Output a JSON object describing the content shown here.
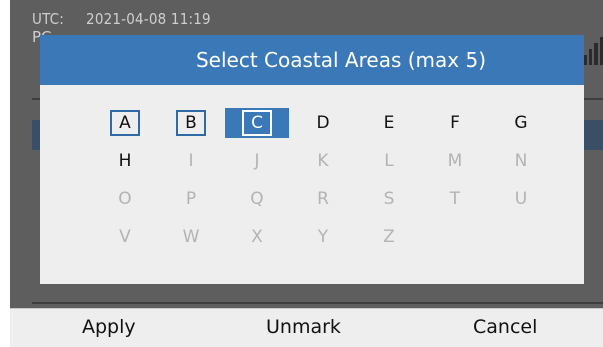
{
  "status": {
    "utc_label": "UTC:",
    "utc_value": "2021-04-08  11:19",
    "line2": "PC"
  },
  "dialog": {
    "title": "Select Coastal Areas (max 5)"
  },
  "areas": [
    {
      "letter": "A",
      "enabled": true,
      "marked": true,
      "focused": false
    },
    {
      "letter": "B",
      "enabled": true,
      "marked": true,
      "focused": false
    },
    {
      "letter": "C",
      "enabled": true,
      "marked": true,
      "focused": true
    },
    {
      "letter": "D",
      "enabled": true,
      "marked": false,
      "focused": false
    },
    {
      "letter": "E",
      "enabled": true,
      "marked": false,
      "focused": false
    },
    {
      "letter": "F",
      "enabled": true,
      "marked": false,
      "focused": false
    },
    {
      "letter": "G",
      "enabled": true,
      "marked": false,
      "focused": false
    },
    {
      "letter": "H",
      "enabled": true,
      "marked": false,
      "focused": false
    },
    {
      "letter": "I",
      "enabled": false,
      "marked": false,
      "focused": false
    },
    {
      "letter": "J",
      "enabled": false,
      "marked": false,
      "focused": false
    },
    {
      "letter": "K",
      "enabled": false,
      "marked": false,
      "focused": false
    },
    {
      "letter": "L",
      "enabled": false,
      "marked": false,
      "focused": false
    },
    {
      "letter": "M",
      "enabled": false,
      "marked": false,
      "focused": false
    },
    {
      "letter": "N",
      "enabled": false,
      "marked": false,
      "focused": false
    },
    {
      "letter": "O",
      "enabled": false,
      "marked": false,
      "focused": false
    },
    {
      "letter": "P",
      "enabled": false,
      "marked": false,
      "focused": false
    },
    {
      "letter": "Q",
      "enabled": false,
      "marked": false,
      "focused": false
    },
    {
      "letter": "R",
      "enabled": false,
      "marked": false,
      "focused": false
    },
    {
      "letter": "S",
      "enabled": false,
      "marked": false,
      "focused": false
    },
    {
      "letter": "T",
      "enabled": false,
      "marked": false,
      "focused": false
    },
    {
      "letter": "U",
      "enabled": false,
      "marked": false,
      "focused": false
    },
    {
      "letter": "V",
      "enabled": false,
      "marked": false,
      "focused": false
    },
    {
      "letter": "W",
      "enabled": false,
      "marked": false,
      "focused": false
    },
    {
      "letter": "X",
      "enabled": false,
      "marked": false,
      "focused": false
    },
    {
      "letter": "Y",
      "enabled": false,
      "marked": false,
      "focused": false
    },
    {
      "letter": "Z",
      "enabled": false,
      "marked": false,
      "focused": false
    }
  ],
  "softkeys": {
    "apply": "Apply",
    "unmark": "Unmark",
    "cancel": "Cancel"
  },
  "icons": {
    "signal": "signal-strength-icon"
  },
  "colors": {
    "title_bar": "#3a78b8",
    "mark_border": "#2f6aa6",
    "focus_fill": "#3a78b8",
    "disabled_text": "#b3b3b3"
  }
}
